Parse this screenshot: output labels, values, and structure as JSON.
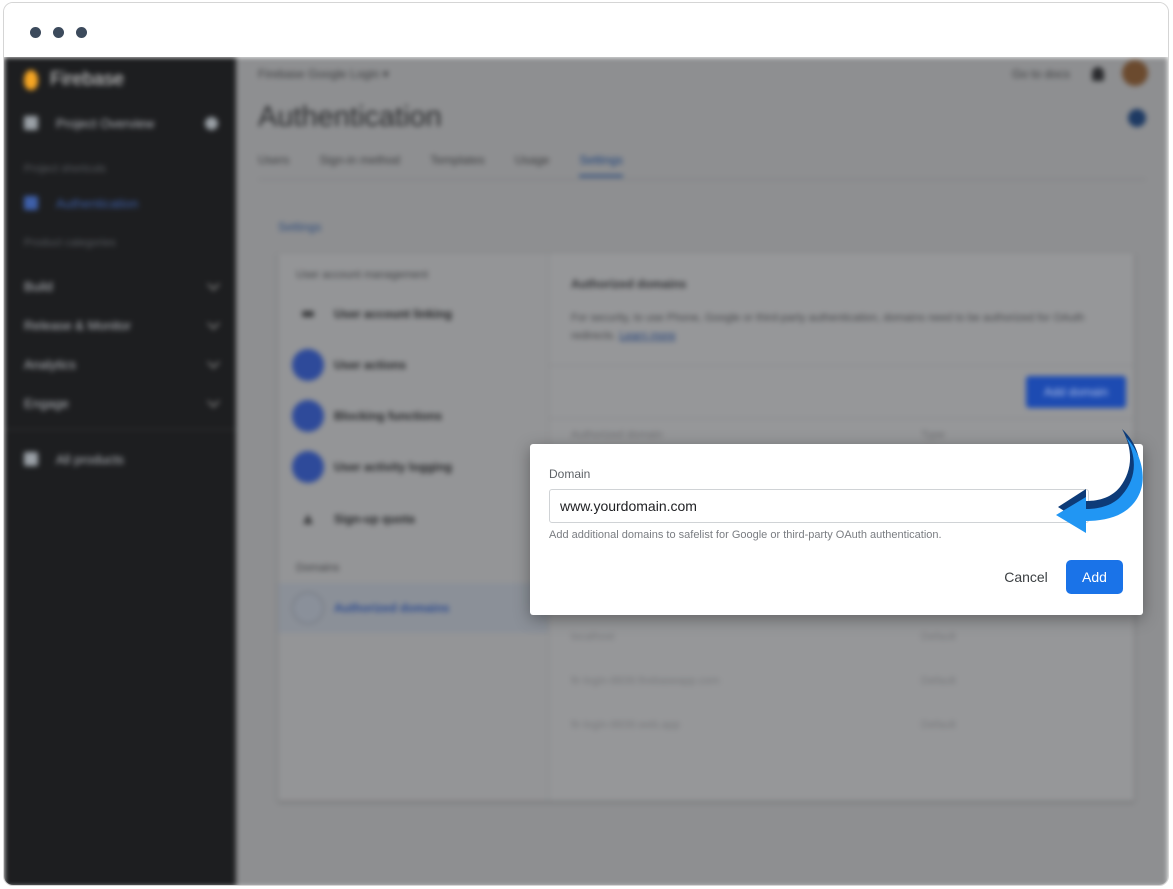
{
  "window": {
    "controls": [
      "close",
      "minimize",
      "maximize"
    ]
  },
  "sidebar": {
    "brand": "Firebase",
    "project_overview": "Project Overview",
    "shortcuts_label": "Project shortcuts",
    "active_item": "Authentication",
    "categories_label": "Product categories",
    "groups": [
      "Build",
      "Release & Monitor",
      "Analytics",
      "Engage"
    ],
    "all_products": "All products"
  },
  "header": {
    "project_name": "Firebase Google Login",
    "go_to_docs": "Go to docs",
    "page_title": "Authentication"
  },
  "tabs": [
    "Users",
    "Sign-in method",
    "Templates",
    "Usage",
    "Settings"
  ],
  "active_tab": "Settings",
  "settings_label": "Settings",
  "settings_nav": {
    "user_mgmt_heading": "User account management",
    "items": [
      "User account linking",
      "User actions",
      "Blocking functions",
      "User activity logging",
      "Sign-up quota"
    ],
    "domains_heading": "Domains",
    "domains_item": "Authorized domains"
  },
  "authorized_domains": {
    "title": "Authorized domains",
    "description": "For security, to use Phone, Google or third-party authentication, domains need to be authorized for OAuth redirects.",
    "learn_more": "Learn more",
    "add_domain_button": "Add domain",
    "columns": {
      "domain": "Authorized domain",
      "type": "Type"
    },
    "rows": [
      {
        "domain": "localhost",
        "type": "Default"
      },
      {
        "domain": "fir-login-8839.firebaseapp.com",
        "type": "Default"
      },
      {
        "domain": "fir-login-8839.web.app",
        "type": "Default"
      }
    ]
  },
  "dialog": {
    "label": "Domain",
    "input_value": "www.yourdomain.com",
    "help_text": "Add additional domains to safelist for Google or third-party OAuth authentication.",
    "cancel": "Cancel",
    "add": "Add"
  },
  "colors": {
    "accent": "#1a73e8",
    "annotation_arrow": "#2196f3",
    "annotation_arrow_dark": "#0d3b78",
    "sidebar_bg": "#1d1e20",
    "overlay_bg": "#8e8f91"
  }
}
